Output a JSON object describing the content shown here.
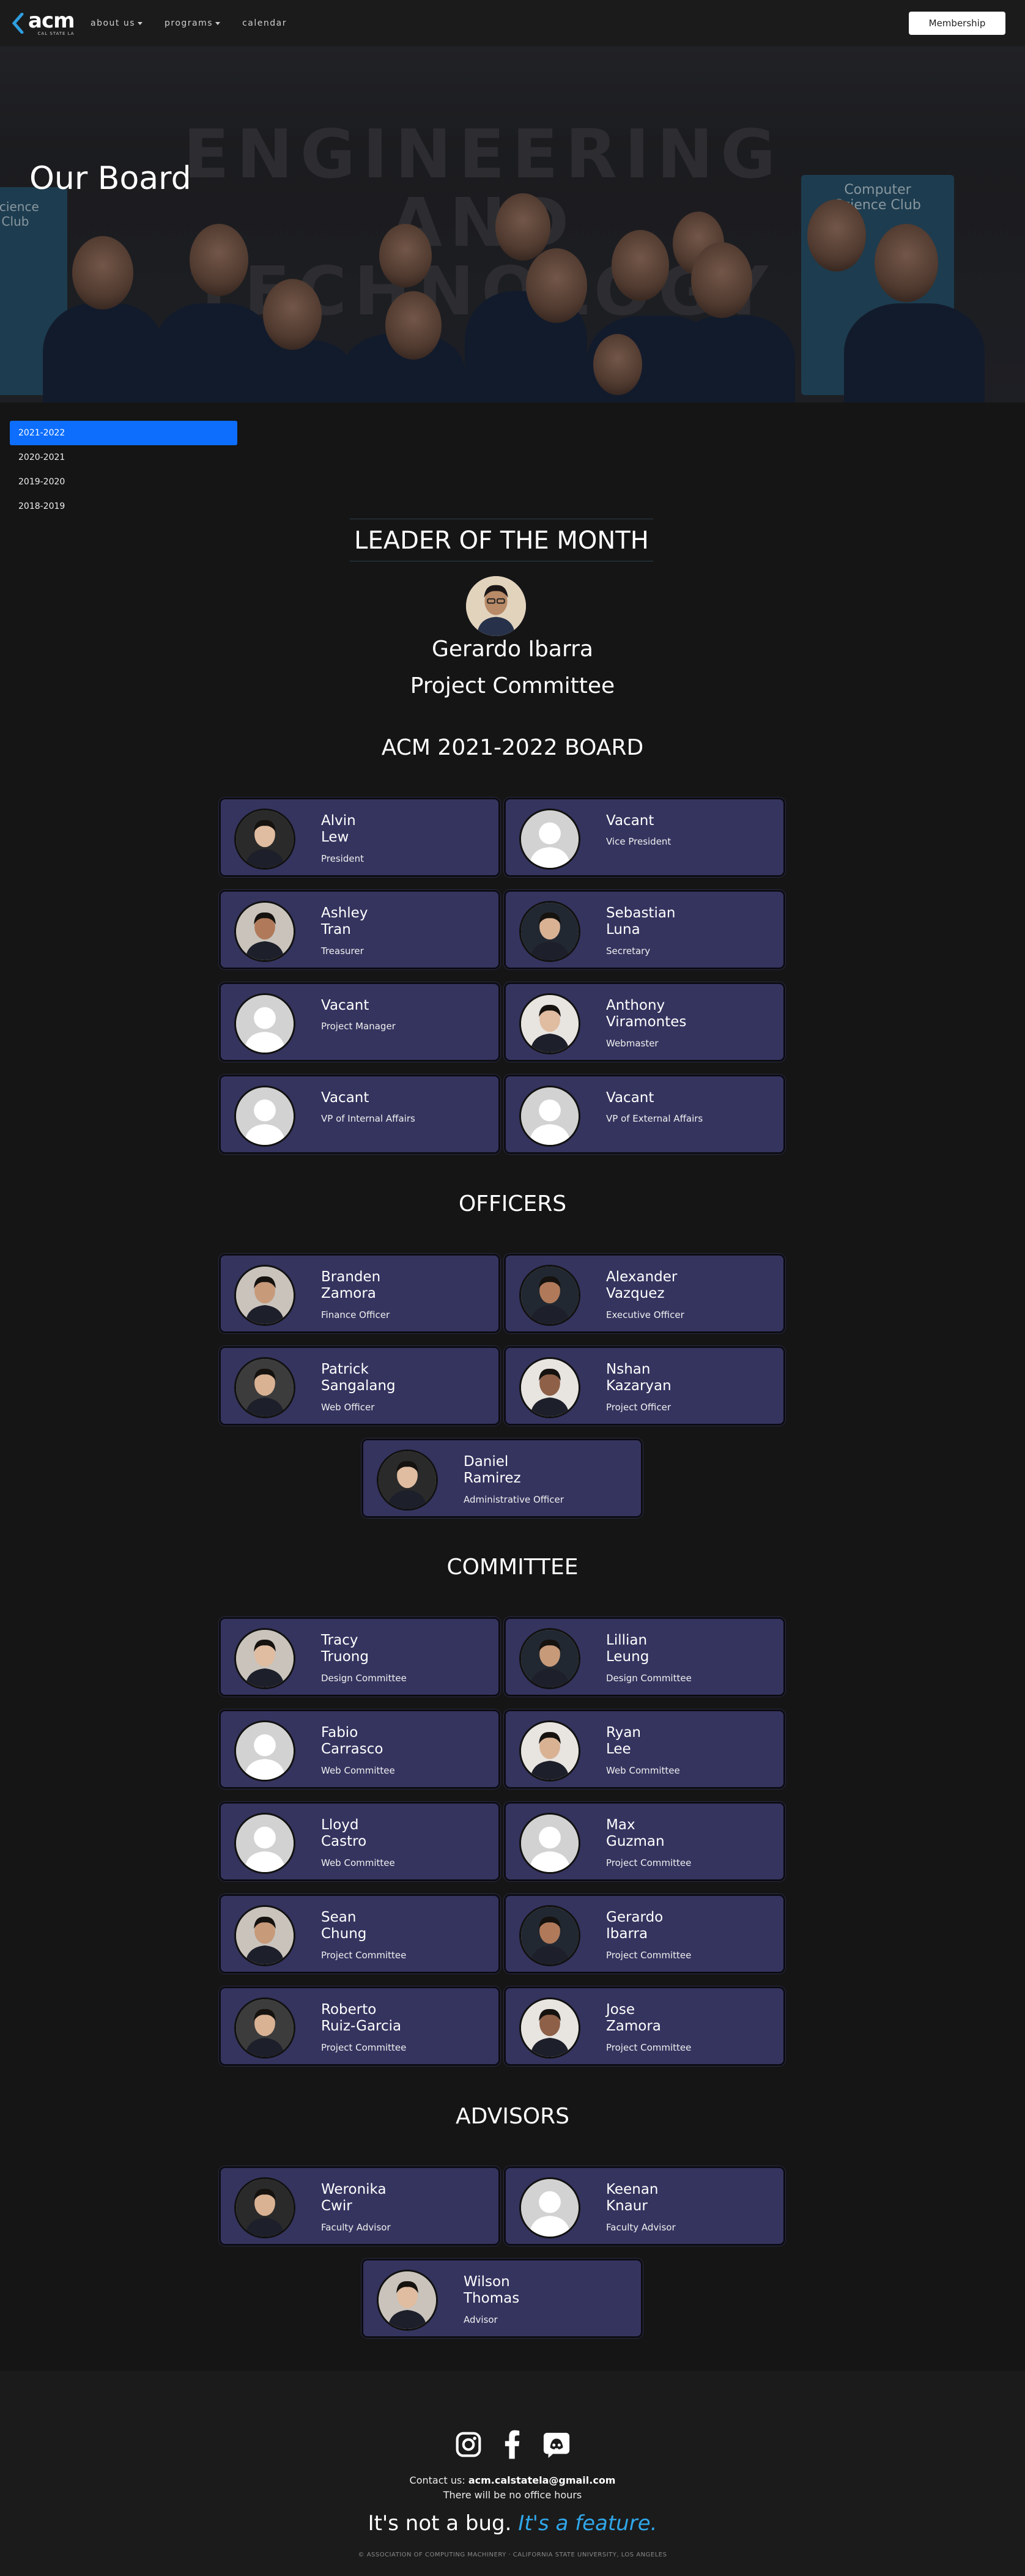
{
  "nav": {
    "logo_text": "acm",
    "logo_sub": "CAL STATE LA",
    "links": [
      "about us",
      "programs",
      "calendar"
    ],
    "membership_label": "Membership"
  },
  "hero": {
    "title": "Our Board",
    "banner_text": "Computer Science Club",
    "left_banner_text": "Science Club",
    "backdrop_text": "ENGINEERING AND TECHNOLOGY"
  },
  "years": [
    "2021-2022",
    "2020-2021",
    "2019-2020",
    "2018-2019"
  ],
  "selected_year": "2021-2022",
  "leader": {
    "heading": "LEADER OF THE MONTH",
    "name": "Gerardo Ibarra",
    "role": "Project Committee"
  },
  "board": {
    "title": "ACM 2021-2022 BOARD",
    "members": [
      {
        "first": "Alvin",
        "last": "Lew",
        "role": "President",
        "photo": "photo"
      },
      {
        "first": "Vacant",
        "last": "",
        "role": "Vice President",
        "photo": "placeholder"
      },
      {
        "first": "Ashley",
        "last": "Tran",
        "role": "Treasurer",
        "photo": "photo"
      },
      {
        "first": "Sebastian",
        "last": "Luna",
        "role": "Secretary",
        "photo": "photo"
      },
      {
        "first": "Vacant",
        "last": "",
        "role": "Project Manager",
        "photo": "placeholder"
      },
      {
        "first": "Anthony",
        "last": "Viramontes",
        "role": "Webmaster",
        "photo": "photo"
      },
      {
        "first": "Vacant",
        "last": "",
        "role": "VP of Internal Affairs",
        "photo": "placeholder"
      },
      {
        "first": "Vacant",
        "last": "",
        "role": "VP of External Affairs",
        "photo": "placeholder"
      }
    ]
  },
  "officers": {
    "title": "OFFICERS",
    "members": [
      {
        "first": "Branden",
        "last": "Zamora",
        "role": "Finance Officer",
        "photo": "photo"
      },
      {
        "first": "Alexander",
        "last": "Vazquez",
        "role": "Executive Officer",
        "photo": "photo"
      },
      {
        "first": "Patrick",
        "last": "Sangalang",
        "role": "Web Officer",
        "photo": "photo"
      },
      {
        "first": "Nshan",
        "last": "Kazaryan",
        "role": "Project Officer",
        "photo": "photo"
      },
      {
        "first": "Daniel",
        "last": "Ramirez",
        "role": "Administrative Officer",
        "photo": "photo"
      }
    ]
  },
  "committee": {
    "title": "COMMITTEE",
    "members": [
      {
        "first": "Tracy",
        "last": "Truong",
        "role": "Design Committee",
        "photo": "photo"
      },
      {
        "first": "Lillian",
        "last": "Leung",
        "role": "Design Committee",
        "photo": "photo"
      },
      {
        "first": "Fabio",
        "last": "Carrasco",
        "role": "Web Committee",
        "photo": "placeholder"
      },
      {
        "first": "Ryan",
        "last": "Lee",
        "role": "Web Committee",
        "photo": "photo"
      },
      {
        "first": "Lloyd",
        "last": "Castro",
        "role": "Web Committee",
        "photo": "placeholder"
      },
      {
        "first": "Max",
        "last": "Guzman",
        "role": "Project Committee",
        "photo": "placeholder"
      },
      {
        "first": "Sean",
        "last": "Chung",
        "role": "Project Committee",
        "photo": "photo"
      },
      {
        "first": "Gerardo",
        "last": "Ibarra",
        "role": "Project Committee",
        "photo": "photo"
      },
      {
        "first": "Roberto",
        "last": "Ruiz-Garcia",
        "role": "Project Committee",
        "photo": "photo"
      },
      {
        "first": "Jose",
        "last": "Zamora",
        "role": "Project Committee",
        "photo": "photo"
      }
    ]
  },
  "advisors": {
    "title": "ADVISORS",
    "members": [
      {
        "first": "Weronika",
        "last": "Cwir",
        "role": "Faculty Advisor",
        "photo": "photo"
      },
      {
        "first": "Keenan",
        "last": "Knaur",
        "role": "Faculty Advisor",
        "photo": "placeholder"
      },
      {
        "first": "Wilson",
        "last": "Thomas",
        "role": "Advisor",
        "photo": "photo"
      }
    ]
  },
  "footer": {
    "social_icons": [
      "instagram-icon",
      "facebook-icon",
      "discord-icon"
    ],
    "contact_prefix": "Contact us: ",
    "contact_email": "acm.calstatela@gmail.com",
    "office_hours": "There will be no office hours",
    "tagline_plain": "It's not a bug. ",
    "tagline_feature": "It's a feature.",
    "copyright": "© ASSOCIATION OF COMPUTING MACHINERY · CALIFORNIA STATE UNIVERSITY, LOS ANGELES"
  },
  "colors": {
    "page_bg": "#151515",
    "card_bg": "#35345f",
    "accent_blue": "#0d6efd",
    "feature_blue": "#2fa7ea"
  }
}
